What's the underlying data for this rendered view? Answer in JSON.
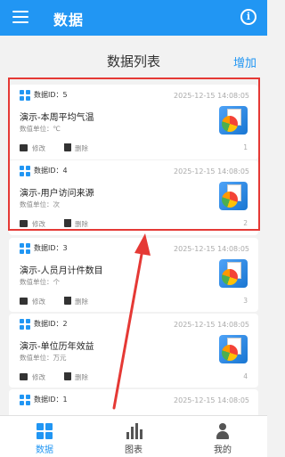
{
  "appbar": {
    "title": "数据"
  },
  "subheader": {
    "title": "数据列表",
    "add_label": "增加"
  },
  "records": [
    {
      "id_label": "数据ID：5",
      "date": "2025-12-15 14:08:05",
      "title": "演示-本周平均气温",
      "unit": "数值单位：℃",
      "edit_label": "修改",
      "delete_label": "删除",
      "index": "1"
    },
    {
      "id_label": "数据ID：4",
      "date": "2025-12-15 14:08:05",
      "title": "演示-用户访问来源",
      "unit": "数值单位：次",
      "edit_label": "修改",
      "delete_label": "删除",
      "index": "2"
    },
    {
      "id_label": "数据ID：3",
      "date": "2025-12-15 14:08:05",
      "title": "演示-人员月计件数目",
      "unit": "数值单位：个",
      "edit_label": "修改",
      "delete_label": "删除",
      "index": "3"
    },
    {
      "id_label": "数据ID：2",
      "date": "2025-12-15 14:08:05",
      "title": "演示-单位历年效益",
      "unit": "数值单位：万元",
      "edit_label": "修改",
      "delete_label": "删除",
      "index": "4"
    },
    {
      "id_label": "数据ID：1",
      "date": "2025-12-15 14:08:05"
    }
  ],
  "bottom_nav": [
    {
      "label": "数据",
      "icon": "grid-icon",
      "active": true
    },
    {
      "label": "图表",
      "icon": "bar-chart-icon",
      "active": false
    },
    {
      "label": "我的",
      "icon": "person-icon",
      "active": false
    }
  ],
  "colors": {
    "primary": "#2196f3",
    "highlight": "#e53935",
    "background": "#f2f2f2"
  }
}
